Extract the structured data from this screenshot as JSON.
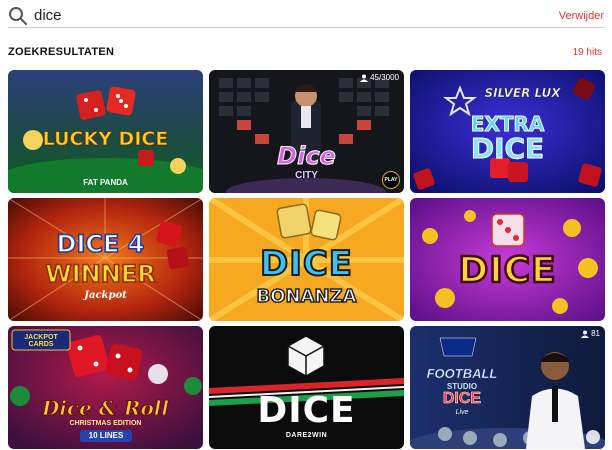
{
  "search": {
    "query": "dice",
    "clear_label": "Verwijder"
  },
  "results": {
    "title": "ZOEKRESULTATEN",
    "count": "19 hits"
  },
  "games": [
    {
      "name": "LUCKY DICE",
      "sub": "FAT PANDA"
    },
    {
      "name": "Dice",
      "sub": "CITY",
      "players": "45/3000",
      "badge": "PLAY"
    },
    {
      "brand": "SILVER LUX",
      "name": "EXTRA",
      "name2": "DICE"
    },
    {
      "name": "DICE 4",
      "name2": "WINNER",
      "sub": "Jackpot"
    },
    {
      "name": "DICE",
      "name2": "BONANZA"
    },
    {
      "name": "DICE"
    },
    {
      "brand": "JACKPOT CARDS",
      "name": "Dice & Roll",
      "sub": "CHRISTMAS EDITION",
      "lines": "10 LINES"
    },
    {
      "name": "DICE",
      "sub": "DARE2WIN"
    },
    {
      "name": "FOOTBALL",
      "name2": "STUDIO",
      "name3": "DICE",
      "sub": "Live",
      "players": "81"
    }
  ]
}
